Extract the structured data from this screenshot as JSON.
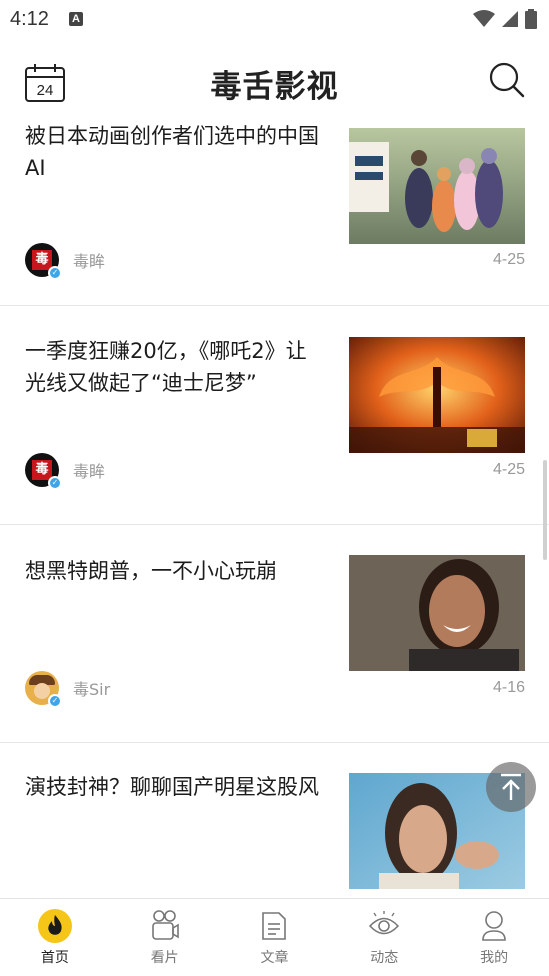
{
  "status_bar": {
    "time": "4:12",
    "notification_badge": "A"
  },
  "header": {
    "logo": "毒舌影视",
    "calendar_day": "24",
    "calendar_icon": "calendar-icon",
    "search_icon": "search-icon"
  },
  "feed": [
    {
      "title": "被日本动画创作者们选中的中国AI",
      "author": "毒眸",
      "date": "4-25",
      "thumb_desc": "anime-poster"
    },
    {
      "title": "一季度狂赚20亿，《哪吒2》让光线又做起了“迪士尼梦”",
      "author": "毒眸",
      "date": "4-25",
      "thumb_desc": "nezha-fire"
    },
    {
      "title": "想黑特朗普，一不小心玩崩",
      "author": "毒Sir",
      "date": "4-16",
      "thumb_desc": "laughing-woman"
    },
    {
      "title": "演技封神？聊聊国产明星这股风",
      "author": "",
      "date": "",
      "thumb_desc": "crying-woman"
    }
  ],
  "tabs": [
    {
      "label": "首页",
      "icon": "home-flame-icon",
      "active": true
    },
    {
      "label": "看片",
      "icon": "film-camera-icon",
      "active": false
    },
    {
      "label": "文章",
      "icon": "document-icon",
      "active": false
    },
    {
      "label": "动态",
      "icon": "eye-icon",
      "active": false
    },
    {
      "label": "我的",
      "icon": "user-icon",
      "active": false
    }
  ],
  "colors": {
    "accent": "#f5c518",
    "verified": "#3fa5e8",
    "muted_text": "#999999"
  }
}
